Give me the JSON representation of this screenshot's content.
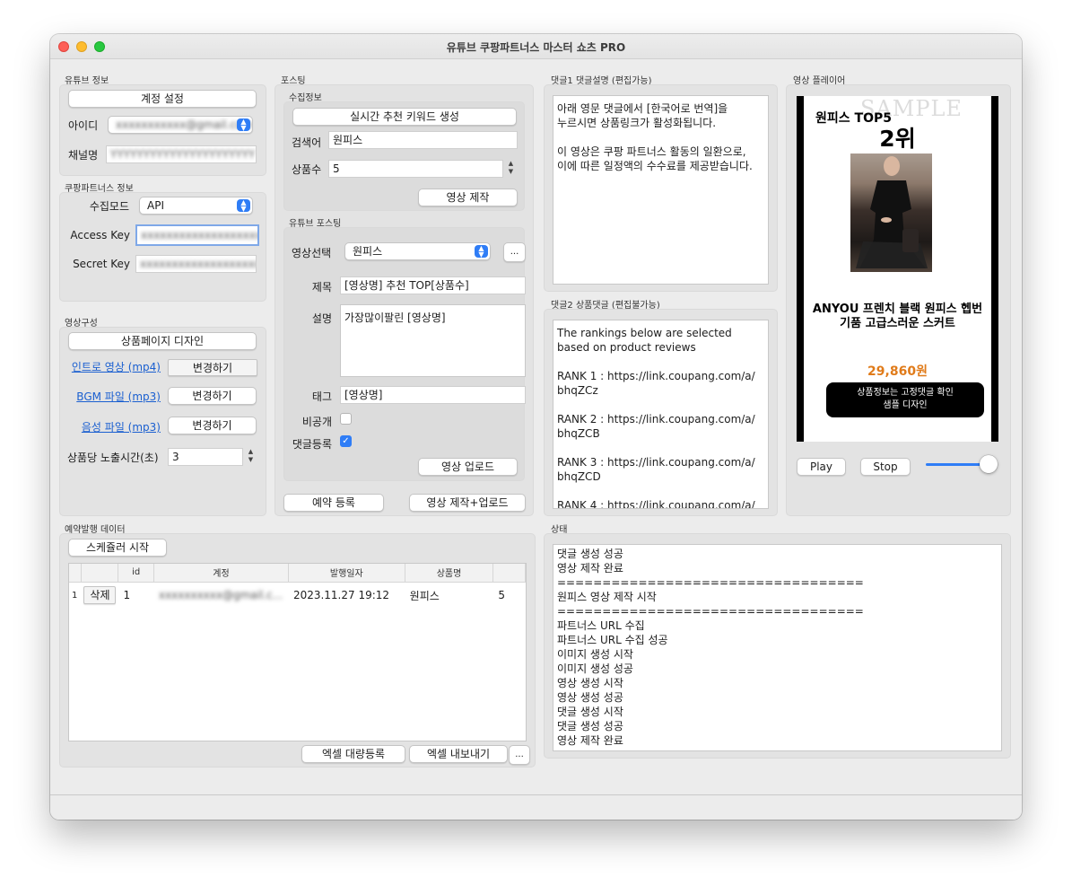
{
  "window": {
    "title": "유튜브 쿠팡파트너스 마스터 쇼츠 PRO"
  },
  "youtube_info": {
    "section_title": "유튜브 정보",
    "account_button": "계정 설정",
    "id_label": "아이디",
    "id_value": "xxxxxxxxxxx@gmail.com",
    "channel_label": "채널명",
    "channel_value": "YYYYYYYYYYYYYYYYYYYYYY"
  },
  "coupang_info": {
    "section_title": "쿠팡파트너스 정보",
    "mode_label": "수집모드",
    "mode_value": "API",
    "access_key_label": "Access Key",
    "access_key_value": "xxxxxxxxxxxxxxxxxxxxxx",
    "secret_key_label": "Secret Key",
    "secret_key_value": "xxxxxxxxxxxxxxxxxxxxxx"
  },
  "video_config": {
    "section_title": "영상구성",
    "design_button": "상품페이지 디자인",
    "intro_label": "인트로 영상 (mp4)",
    "bgm_label": "BGM 파일 (mp3)",
    "voice_label": "음성 파일 (mp3)",
    "change_button": "변경하기",
    "exposure_label": "상품당 노출시간(초)",
    "exposure_value": "3"
  },
  "posting": {
    "section_title": "포스팅",
    "collect_title": "수집정보",
    "keyword_button": "실시간 추천 키워드 생성",
    "search_label": "검색어",
    "search_value": "원피스",
    "count_label": "상품수",
    "count_value": "5",
    "make_button": "영상 제작",
    "yt_post_title": "유튜브 포스팅",
    "video_select_label": "영상선택",
    "video_select_value": "원피스",
    "more_button": "...",
    "title_label": "제목",
    "title_value": "[영상명] 추천 TOP[상품수]",
    "desc_label": "설명",
    "desc_value": "가장많이팔린 [영상명]",
    "tag_label": "태그",
    "tag_value": "[영상명]",
    "private_label": "비공개",
    "comment_label": "댓글등록",
    "upload_button": "영상 업로드",
    "reserve_button": "예약 등록",
    "make_upload_button": "영상 제작+업로드"
  },
  "comment1": {
    "title": "댓글1 댓글설명 (편집가능)",
    "text": "아래 영문 댓글에서 [한국어로 번역]을\n누르시면 상품링크가 활성화됩니다.\n\n이 영상은 쿠팡 파트너스 활동의 일환으로,\n이에 따른 일정액의 수수료를 제공받습니다."
  },
  "comment2": {
    "title": "댓글2 상품댓글 (편집불가능)",
    "text": "The rankings below are selected\nbased on product reviews\n\nRANK 1 : https://link.coupang.com/a/\nbhqZCz\n\nRANK 2 : https://link.coupang.com/a/\nbhqZCB\n\nRANK 3 : https://link.coupang.com/a/\nbhqZCD\n\nRANK 4 : https://link.coupang.com/a/"
  },
  "player": {
    "title": "영상 플레이어",
    "watermark": "SAMPLE",
    "topline": "원피스 TOP5",
    "rank": "2위",
    "product_name_1": "ANYOU 프렌치 블랙 원피스 헵번",
    "product_name_2": "기품 고급스러운 스커트",
    "price": "29,860원",
    "cta_line1": "상품정보는 고정댓글 확인",
    "cta_line2": "샘플 디자인",
    "play_button": "Play",
    "stop_button": "Stop",
    "volume": 1.0
  },
  "schedule": {
    "title": "예약발행 데이터",
    "start_button": "스케쥴러 시작",
    "columns": [
      "",
      "id",
      "계정",
      "발행일자",
      "상품명",
      ""
    ],
    "rows": [
      {
        "row_num": "1",
        "delete": "삭제",
        "id": "1",
        "account": "xxxxxxxxxx@gmail.c...",
        "date": "2023.11.27 19:12",
        "product": "원피스",
        "count": "5"
      }
    ],
    "excel_import_button": "엑셀 대량등록",
    "excel_export_button": "엑셀 내보내기",
    "more_button": "..."
  },
  "status": {
    "title": "상태",
    "lines": [
      "댓글 생성 성공",
      "영상 제작 완료",
      "==================================",
      "원피스 영상 제작 시작",
      "==================================",
      "파트너스 URL 수집",
      "파트너스 URL 수집 성공",
      "이미지 생성 시작",
      "이미지 생성 성공",
      "영상 생성 시작",
      "영상 생성 성공",
      "댓글 생성 시작",
      "댓글 생성 성공",
      "영상 제작 완료"
    ]
  },
  "colors": {
    "accent": "#2f7df6",
    "price": "#e07b1a",
    "link": "#1a5fd0"
  }
}
